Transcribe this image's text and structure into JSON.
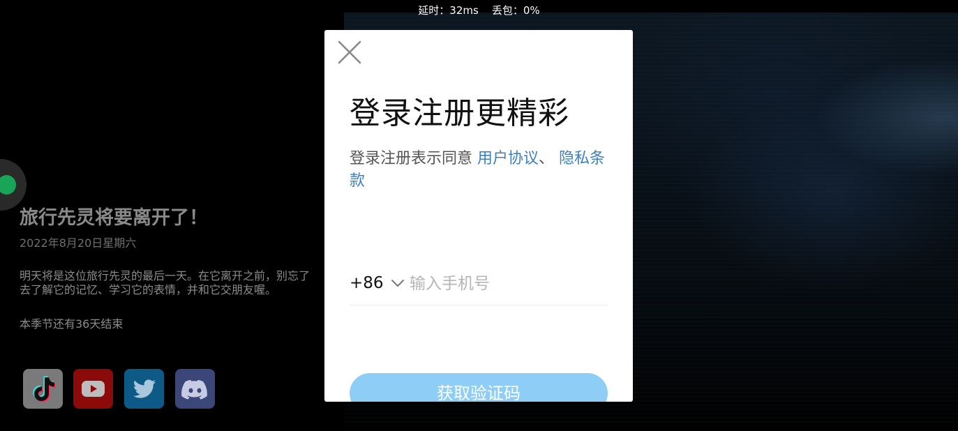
{
  "status_bar": {
    "text": "延时：32ms    丢包：0%"
  },
  "event": {
    "title": "旅行先灵将要离开了！",
    "date": "2022年8月20日星期六",
    "description": "明天将是这位旅行先灵的最后一天。在它离开之前，别忘了去了解它的记忆、学习它的表情，并和它交朋友喔。",
    "countdown": "本季节还有36天结束"
  },
  "social": [
    {
      "icon": "tiktok-icon",
      "color": "#7a7a7a"
    },
    {
      "icon": "youtube-icon",
      "color": "#8b0b0b"
    },
    {
      "icon": "twitter-icon",
      "color": "#0e5a86"
    },
    {
      "icon": "discord-icon",
      "color": "#3b4679"
    }
  ],
  "login": {
    "close_icon": "close-icon",
    "title": "登录注册更精彩",
    "agreement_prefix": "登录注册表示同意 ",
    "user_agreement_link": "用户协议",
    "separator": "、 ",
    "privacy_link": "隐私条款",
    "country_code": "+86",
    "phone_placeholder": "输入手机号",
    "phone_value": "",
    "get_code_label": "获取验证码",
    "accent_color": "#3d7fc1",
    "button_color": "#8ecdf6"
  }
}
